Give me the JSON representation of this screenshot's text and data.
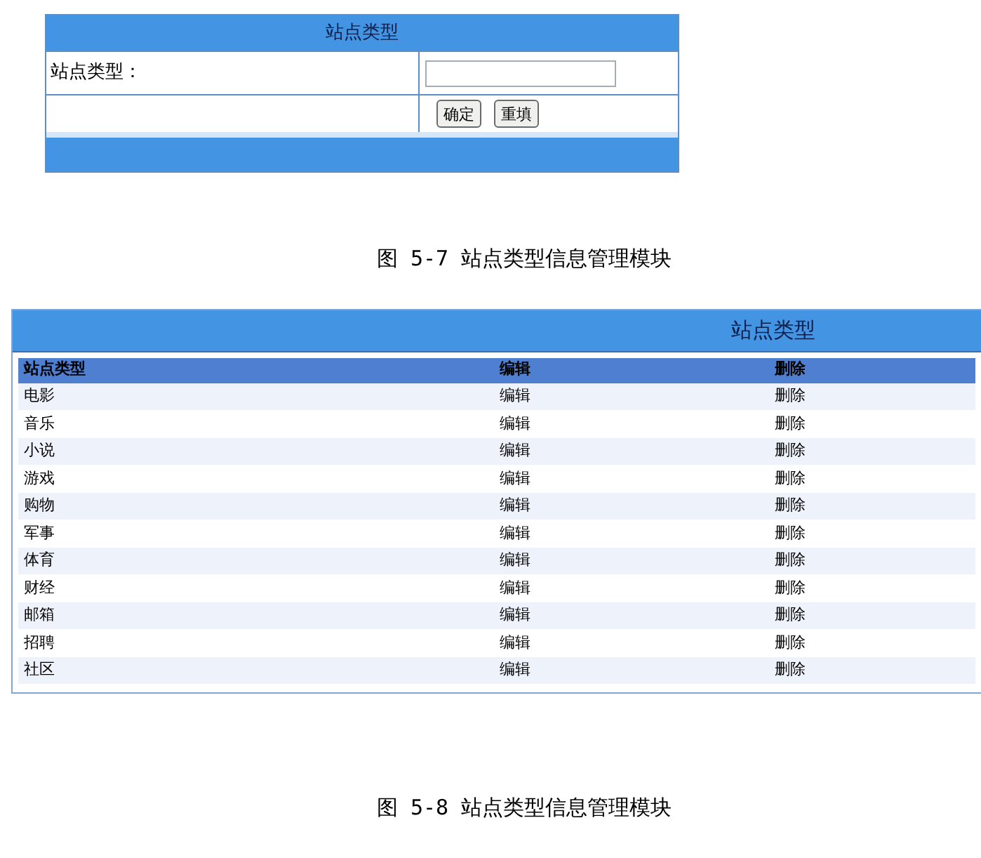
{
  "form_panel": {
    "title": "站点类型",
    "field_label": "站点类型：",
    "buttons": [
      "确定",
      "重填"
    ]
  },
  "caption_1": "图 5-7 站点类型信息管理模块",
  "list_panel": {
    "title": "站点类型",
    "columns": [
      "站点类型",
      "编辑",
      "删除"
    ],
    "rows": [
      {
        "name": "电影",
        "edit": "编辑",
        "delete": "删除"
      },
      {
        "name": "音乐",
        "edit": "编辑",
        "delete": "删除"
      },
      {
        "name": "小说",
        "edit": "编辑",
        "delete": "删除"
      },
      {
        "name": "游戏",
        "edit": "编辑",
        "delete": "删除"
      },
      {
        "name": "购物",
        "edit": "编辑",
        "delete": "删除"
      },
      {
        "name": "军事",
        "edit": "编辑",
        "delete": "删除"
      },
      {
        "name": "体育",
        "edit": "编辑",
        "delete": "删除"
      },
      {
        "name": "财经",
        "edit": "编辑",
        "delete": "删除"
      },
      {
        "name": "邮箱",
        "edit": "编辑",
        "delete": "删除"
      },
      {
        "name": "招聘",
        "edit": "编辑",
        "delete": "删除"
      },
      {
        "name": "社区",
        "edit": "编辑",
        "delete": "删除"
      }
    ]
  },
  "caption_2": "图 5-8 站点类型信息管理模块"
}
